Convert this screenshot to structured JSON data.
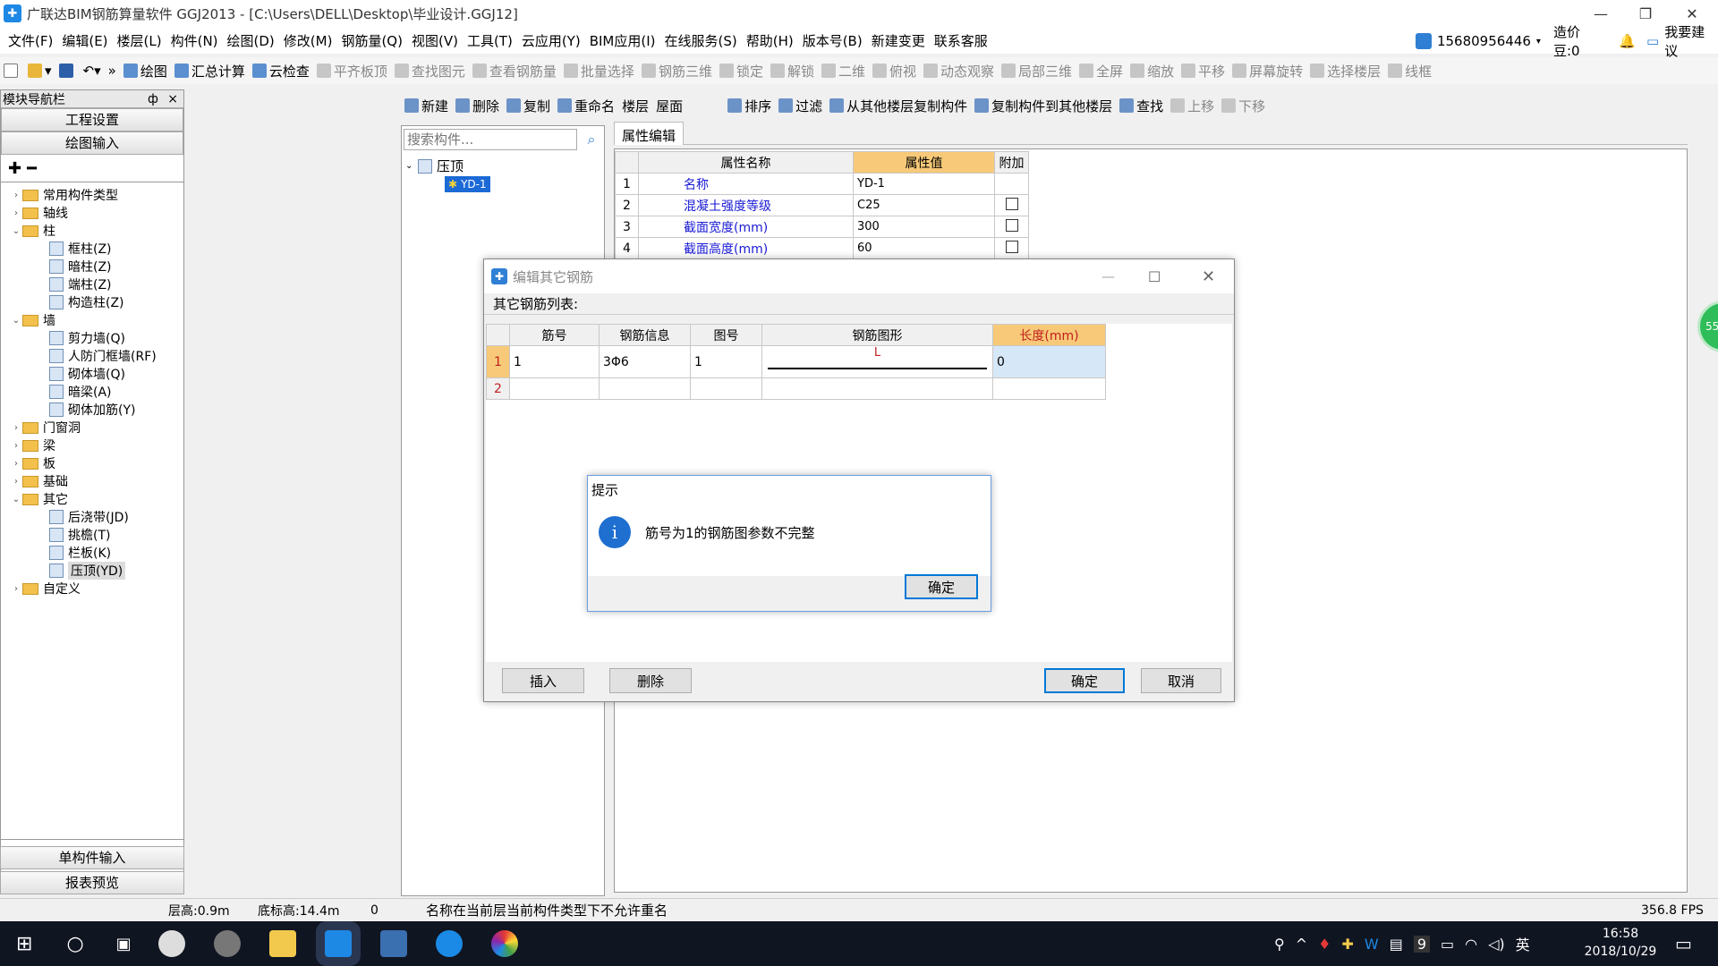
{
  "window": {
    "title": "广联达BIM钢筋算量软件 GGJ2013 - [C:\\Users\\DELL\\Desktop\\毕业设计.GGJ12]"
  },
  "menu": [
    "文件(F)",
    "编辑(E)",
    "楼层(L)",
    "构件(N)",
    "绘图(D)",
    "修改(M)",
    "钢筋量(Q)",
    "视图(V)",
    "工具(T)",
    "云应用(Y)",
    "BIM应用(I)",
    "在线服务(S)",
    "帮助(H)",
    "版本号(B)",
    "新建变更",
    "联系客服"
  ],
  "account": {
    "phone": "15680956446",
    "price_beans": "造价豆:0",
    "suggest": "我要建议"
  },
  "toolbar": [
    "绘图",
    "汇总计算",
    "云检查",
    "平齐板顶",
    "查找图元",
    "查看钢筋量",
    "批量选择",
    "钢筋三维",
    "锁定",
    "解锁",
    "二维",
    "俯视",
    "动态观察",
    "局部三维",
    "全屏",
    "缩放",
    "平移",
    "屏幕旋转",
    "选择楼层",
    "线框"
  ],
  "nav": {
    "title": "模块导航栏",
    "pin": "ф",
    "close": "×",
    "top_buttons": [
      "工程设置",
      "绘图输入"
    ],
    "bottom_buttons": [
      "单构件输入",
      "报表预览"
    ],
    "tree": [
      {
        "label": "常用构件类型",
        "level": 0,
        "type": "folder",
        "arrow": "›"
      },
      {
        "label": "轴线",
        "level": 0,
        "type": "folder",
        "arrow": "›"
      },
      {
        "label": "柱",
        "level": 0,
        "type": "folder",
        "arrow": "⌄"
      },
      {
        "label": "框柱(Z)",
        "level": 1,
        "type": "comp"
      },
      {
        "label": "暗柱(Z)",
        "level": 1,
        "type": "comp"
      },
      {
        "label": "端柱(Z)",
        "level": 1,
        "type": "comp"
      },
      {
        "label": "构造柱(Z)",
        "level": 1,
        "type": "comp"
      },
      {
        "label": "墙",
        "level": 0,
        "type": "folder",
        "arrow": "⌄"
      },
      {
        "label": "剪力墙(Q)",
        "level": 1,
        "type": "comp"
      },
      {
        "label": "人防门框墙(RF)",
        "level": 1,
        "type": "comp"
      },
      {
        "label": "砌体墙(Q)",
        "level": 1,
        "type": "comp"
      },
      {
        "label": "暗梁(A)",
        "level": 1,
        "type": "comp"
      },
      {
        "label": "砌体加筋(Y)",
        "level": 1,
        "type": "comp"
      },
      {
        "label": "门窗洞",
        "level": 0,
        "type": "folder",
        "arrow": "›"
      },
      {
        "label": "梁",
        "level": 0,
        "type": "folder",
        "arrow": "›"
      },
      {
        "label": "板",
        "level": 0,
        "type": "folder",
        "arrow": "›"
      },
      {
        "label": "基础",
        "level": 0,
        "type": "folder",
        "arrow": "›"
      },
      {
        "label": "其它",
        "level": 0,
        "type": "folder",
        "arrow": "⌄"
      },
      {
        "label": "后浇带(JD)",
        "level": 1,
        "type": "comp"
      },
      {
        "label": "挑檐(T)",
        "level": 1,
        "type": "comp"
      },
      {
        "label": "栏板(K)",
        "level": 1,
        "type": "comp"
      },
      {
        "label": "压顶(YD)",
        "level": 1,
        "type": "comp",
        "selected": true
      },
      {
        "label": "自定义",
        "level": 0,
        "type": "folder",
        "arrow": "›"
      }
    ]
  },
  "comp_toolbar": [
    "新建",
    "删除",
    "复制",
    "重命名",
    "楼层",
    "屋面",
    "排序",
    "过滤",
    "从其他楼层复制构件",
    "复制构件到其他楼层",
    "查找",
    "上移",
    "下移"
  ],
  "search": {
    "placeholder": "搜索构件..."
  },
  "comp_tree": {
    "root": "压顶",
    "child": "YD-1"
  },
  "props": {
    "tab": "属性编辑",
    "headers": [
      "属性名称",
      "属性值",
      "附加"
    ],
    "rows": [
      {
        "no": "1",
        "name": "名称",
        "value": "YD-1",
        "check": false
      },
      {
        "no": "2",
        "name": "混凝土强度等级",
        "value": "C25",
        "check": true
      },
      {
        "no": "3",
        "name": "截面宽度(mm)",
        "value": "300",
        "check": true
      },
      {
        "no": "4",
        "name": "截面高度(mm)",
        "value": "60",
        "check": true
      }
    ]
  },
  "dialog": {
    "title": "编辑其它钢筋",
    "list_label": "其它钢筋列表:",
    "headers": [
      "筋号",
      "钢筋信息",
      "图号",
      "钢筋图形",
      "长度(mm)"
    ],
    "rows": [
      {
        "no": "1",
        "bar_no": "1",
        "info": "3Φ6",
        "fig": "1",
        "shape_label": "L",
        "length": "0"
      },
      {
        "no": "2",
        "bar_no": "",
        "info": "",
        "fig": "",
        "shape_label": "",
        "length": ""
      }
    ],
    "buttons": {
      "insert": "插入",
      "delete": "删除",
      "ok": "确定",
      "cancel": "取消"
    }
  },
  "alert": {
    "title": "提示",
    "message": "筋号为1的钢筋图参数不完整",
    "ok": "确定",
    "icon": "info-icon"
  },
  "statusbar": {
    "floor_height": "层高:0.9m",
    "bottom_elev": "底标高:14.4m",
    "count": "0",
    "message": "名称在当前层当前构件类型下不允许重名",
    "fps": "356.8 FPS"
  },
  "side_badge": "55",
  "tray": {
    "ime": "英",
    "num": "9",
    "time": "16:58",
    "date": "2018/10/29"
  },
  "colors": {
    "accent": "#0078d7",
    "header_orange": "#f7c978",
    "link_blue": "#1a1ad6",
    "selected_row": "#cde4f7",
    "taskbar": "#101522"
  }
}
